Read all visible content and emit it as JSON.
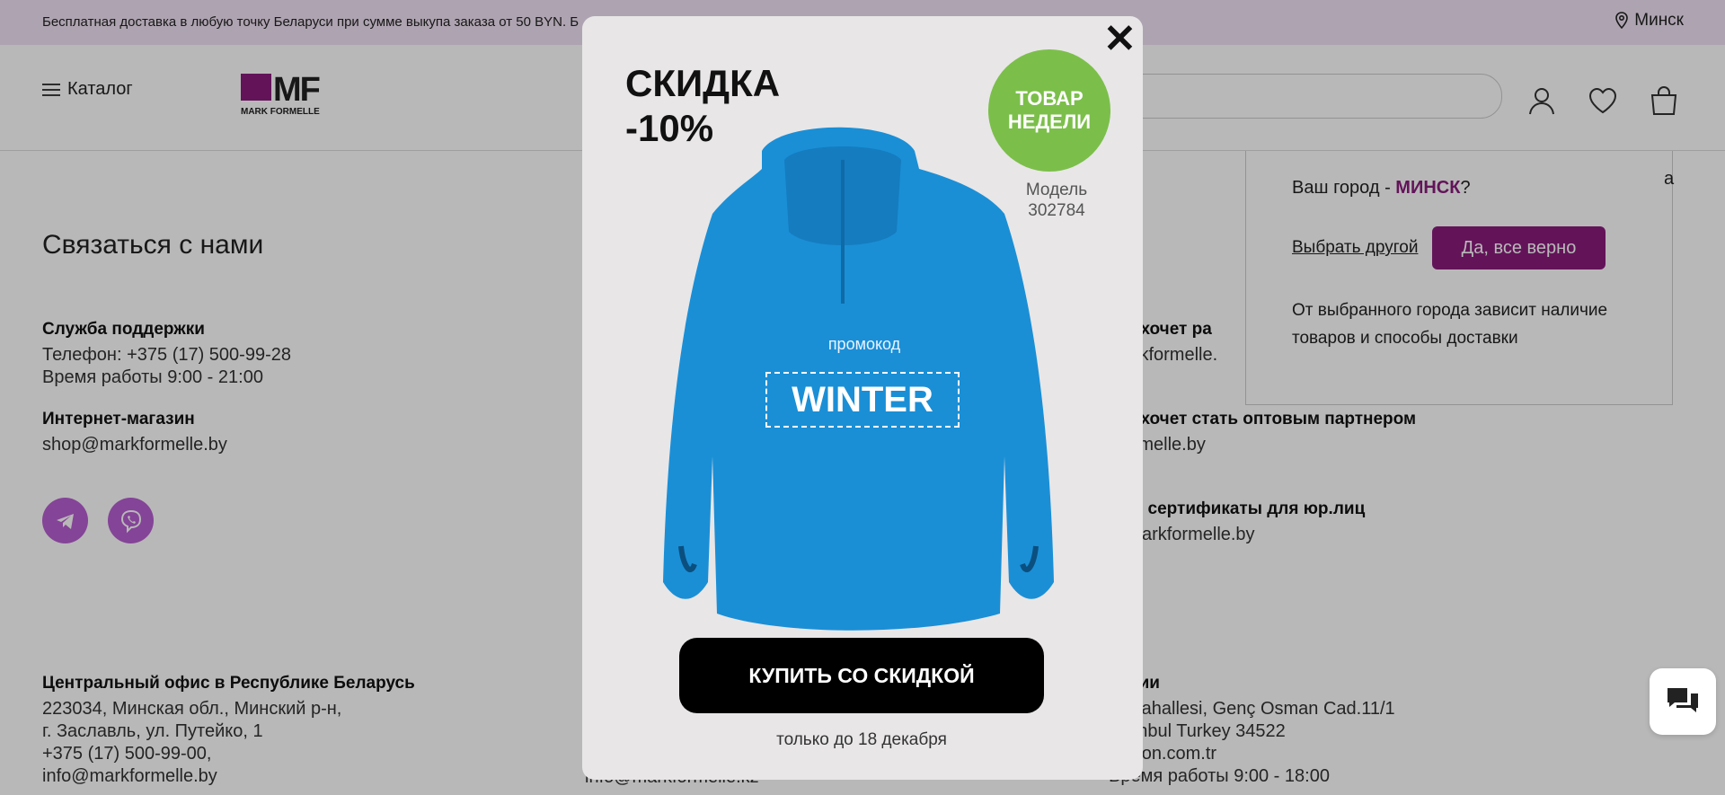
{
  "topbar": {
    "promo": "Бесплатная доставка в любую точку Беларуси при сумме выкупа заказа от 50 BYN. Б",
    "city": "Минск"
  },
  "header": {
    "catalog": "Каталог",
    "logo_letters": "MF",
    "logo_text": "MARK FORMELLE"
  },
  "contacts": {
    "title": "Связаться с нами",
    "support": {
      "title": "Служба поддержки",
      "phone": "Телефон: +375 (17) 500-99-28",
      "hours": "Время работы 9:00 - 21:00"
    },
    "shop": {
      "title": "Интернет-магазин",
      "email": "shop@markformelle.by"
    },
    "right_blocks": [
      {
        "title": "кто хочет ра",
        "line": "markformelle."
      },
      {
        "title": "кто хочет стать оптовым партнером",
        "line": "kformelle.by"
      },
      {
        "title": "ные сертификаты для юр.лиц",
        "line": "@markformelle.by"
      }
    ],
    "central_office": {
      "title": "Центральный офис в Республике Беларусь",
      "lines": [
        "223034, Минская обл., Минский р-н,",
        "г. Заславль, ул. Путейко, 1",
        "+375 (17) 500-99-00,",
        "info@markformelle.by"
      ]
    },
    "kz_fragment": "info@markformelle.kz",
    "turkey": {
      "title": "урции",
      "lines": [
        "zi Mahallesi, Genç Osman Cad.11/1",
        "İstanbul Turkey 34522",
        "ashion.com.tr",
        "Время работы 9:00 - 18:00"
      ]
    }
  },
  "city_popup": {
    "question_prefix": "Ваш город - ",
    "city": "МИНСК",
    "question_suffix": "?",
    "other": "Выбрать другой",
    "confirm": "Да, все верно",
    "note": "От выбранного города зависит наличие товаров и способы доставки",
    "edge_fragment": "а"
  },
  "modal": {
    "discount_line1": "СКИДКА",
    "discount_line2": "-10%",
    "badge_line1": "ТОВАР",
    "badge_line2": "НЕДЕЛИ",
    "model_label": "Модель",
    "model_number": "302784",
    "promo_label": "промокод",
    "promo_code": "WINTER",
    "buy_button": "КУПИТЬ СО СКИДКОЙ",
    "until": "только до 18 декабря"
  },
  "colors": {
    "brand": "#8a1c7c",
    "topbar": "#f1e3f5",
    "badge": "#7bbf4a",
    "garment": "#1a8fd6"
  }
}
